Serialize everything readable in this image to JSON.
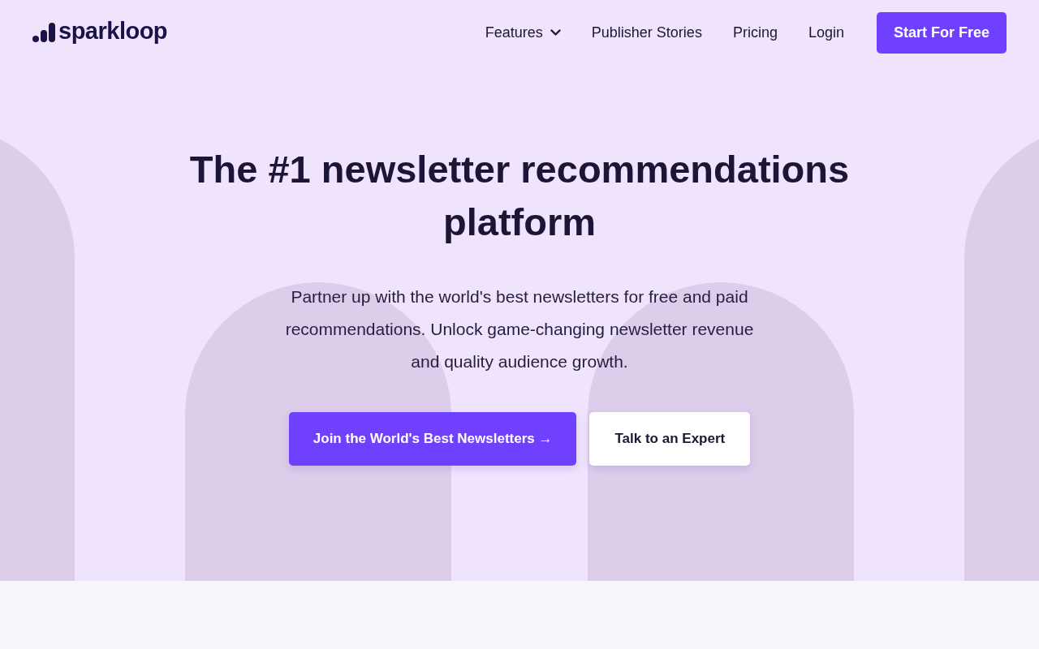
{
  "header": {
    "logo": {
      "text": "sparkloop"
    },
    "nav": [
      {
        "label": "Features",
        "kind": "dropdown"
      },
      {
        "label": "Publisher Stories",
        "kind": "link"
      },
      {
        "label": "Pricing",
        "kind": "link"
      },
      {
        "label": "Login",
        "kind": "link"
      }
    ],
    "cta": "Start For Free"
  },
  "hero": {
    "title": "The #1 newsletter recommendations platform",
    "subtitle": "Partner up with the world's best newsletters for free and paid recommendations. Unlock game-changing newsletter revenue and quality audience growth.",
    "buttons": [
      {
        "label": "Join the World's Best Newsletters →",
        "kind": "primary"
      },
      {
        "label": "Talk to an Expert",
        "kind": "secondary"
      }
    ]
  }
}
